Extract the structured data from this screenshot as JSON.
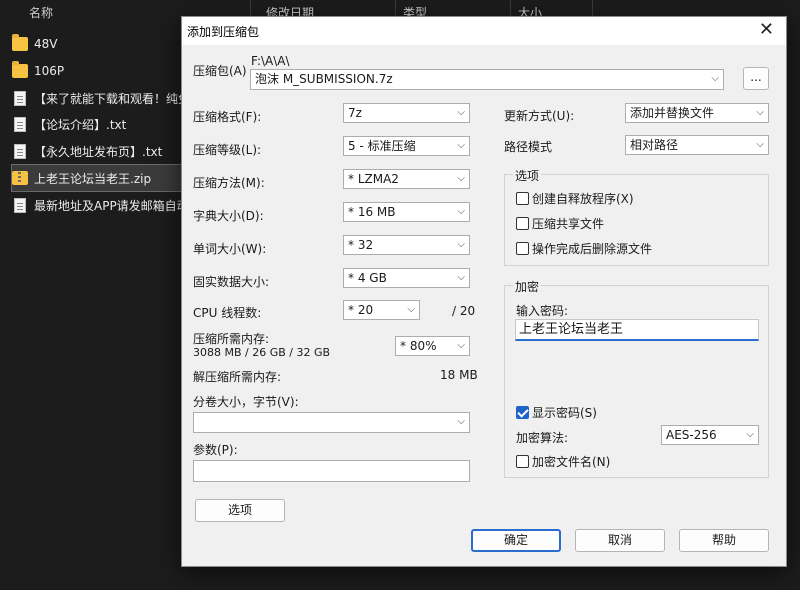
{
  "explorer": {
    "columns": {
      "name": "名称",
      "modified": "修改日期",
      "type": "类型",
      "size": "大小"
    },
    "files": [
      {
        "name": "48V",
        "icon": "folder-icon"
      },
      {
        "name": "106P",
        "icon": "folder-icon"
      },
      {
        "name": "【来了就能下载和观看！纯免",
        "icon": "doc-icon"
      },
      {
        "name": "【论坛介绍】.txt",
        "icon": "doc-icon"
      },
      {
        "name": "【永久地址发布页】.txt",
        "icon": "doc-icon"
      },
      {
        "name": "上老王论坛当老王.zip",
        "icon": "zip-icon"
      },
      {
        "name": "最新地址及APP请发邮箱自动",
        "icon": "doc-icon"
      }
    ]
  },
  "dialog": {
    "title": "添加到压缩包",
    "close": "✕",
    "archive": {
      "label": "压缩包(A)",
      "path": "F:\\A\\A\\",
      "filename": "泡沫 M_SUBMISSION.7z",
      "browse": "..."
    },
    "left": {
      "format": {
        "label": "压缩格式(F):",
        "value": "7z"
      },
      "level": {
        "label": "压缩等级(L):",
        "value": "5 - 标准压缩"
      },
      "method": {
        "label": "压缩方法(M):",
        "value": "* LZMA2"
      },
      "dict": {
        "label": "字典大小(D):",
        "value": "* 16 MB"
      },
      "word": {
        "label": "单词大小(W):",
        "value": "* 32"
      },
      "solid": {
        "label": "固实数据大小:",
        "value": "* 4 GB"
      },
      "threads": {
        "label": "CPU 线程数:",
        "value": "* 20",
        "max": "/ 20"
      },
      "mem_compress": {
        "label": "压缩所需内存:",
        "detail": "3088 MB / 26 GB / 32 GB",
        "value": "* 80%"
      },
      "mem_decompress": {
        "label": "解压缩所需内存:",
        "value": "18 MB"
      },
      "split": {
        "label": "分卷大小，字节(V):",
        "value": ""
      },
      "params": {
        "label": "参数(P):",
        "value": ""
      },
      "options_button": "选项"
    },
    "right": {
      "update": {
        "label": "更新方式(U):",
        "value": "添加并替换文件"
      },
      "path_mode": {
        "label": "路径模式",
        "value": "相对路径"
      },
      "options": {
        "title": "选项",
        "sfx": "创建自释放程序(X)",
        "shared": "压缩共享文件",
        "delete": "操作完成后删除源文件"
      },
      "encryption": {
        "title": "加密",
        "password_label": "输入密码:",
        "password": "上老王论坛当老王",
        "show_password": "显示密码(S)",
        "method_label": "加密算法:",
        "method": "AES-256",
        "encrypt_names": "加密文件名(N)"
      }
    },
    "buttons": {
      "ok": "确定",
      "cancel": "取消",
      "help": "帮助"
    }
  }
}
